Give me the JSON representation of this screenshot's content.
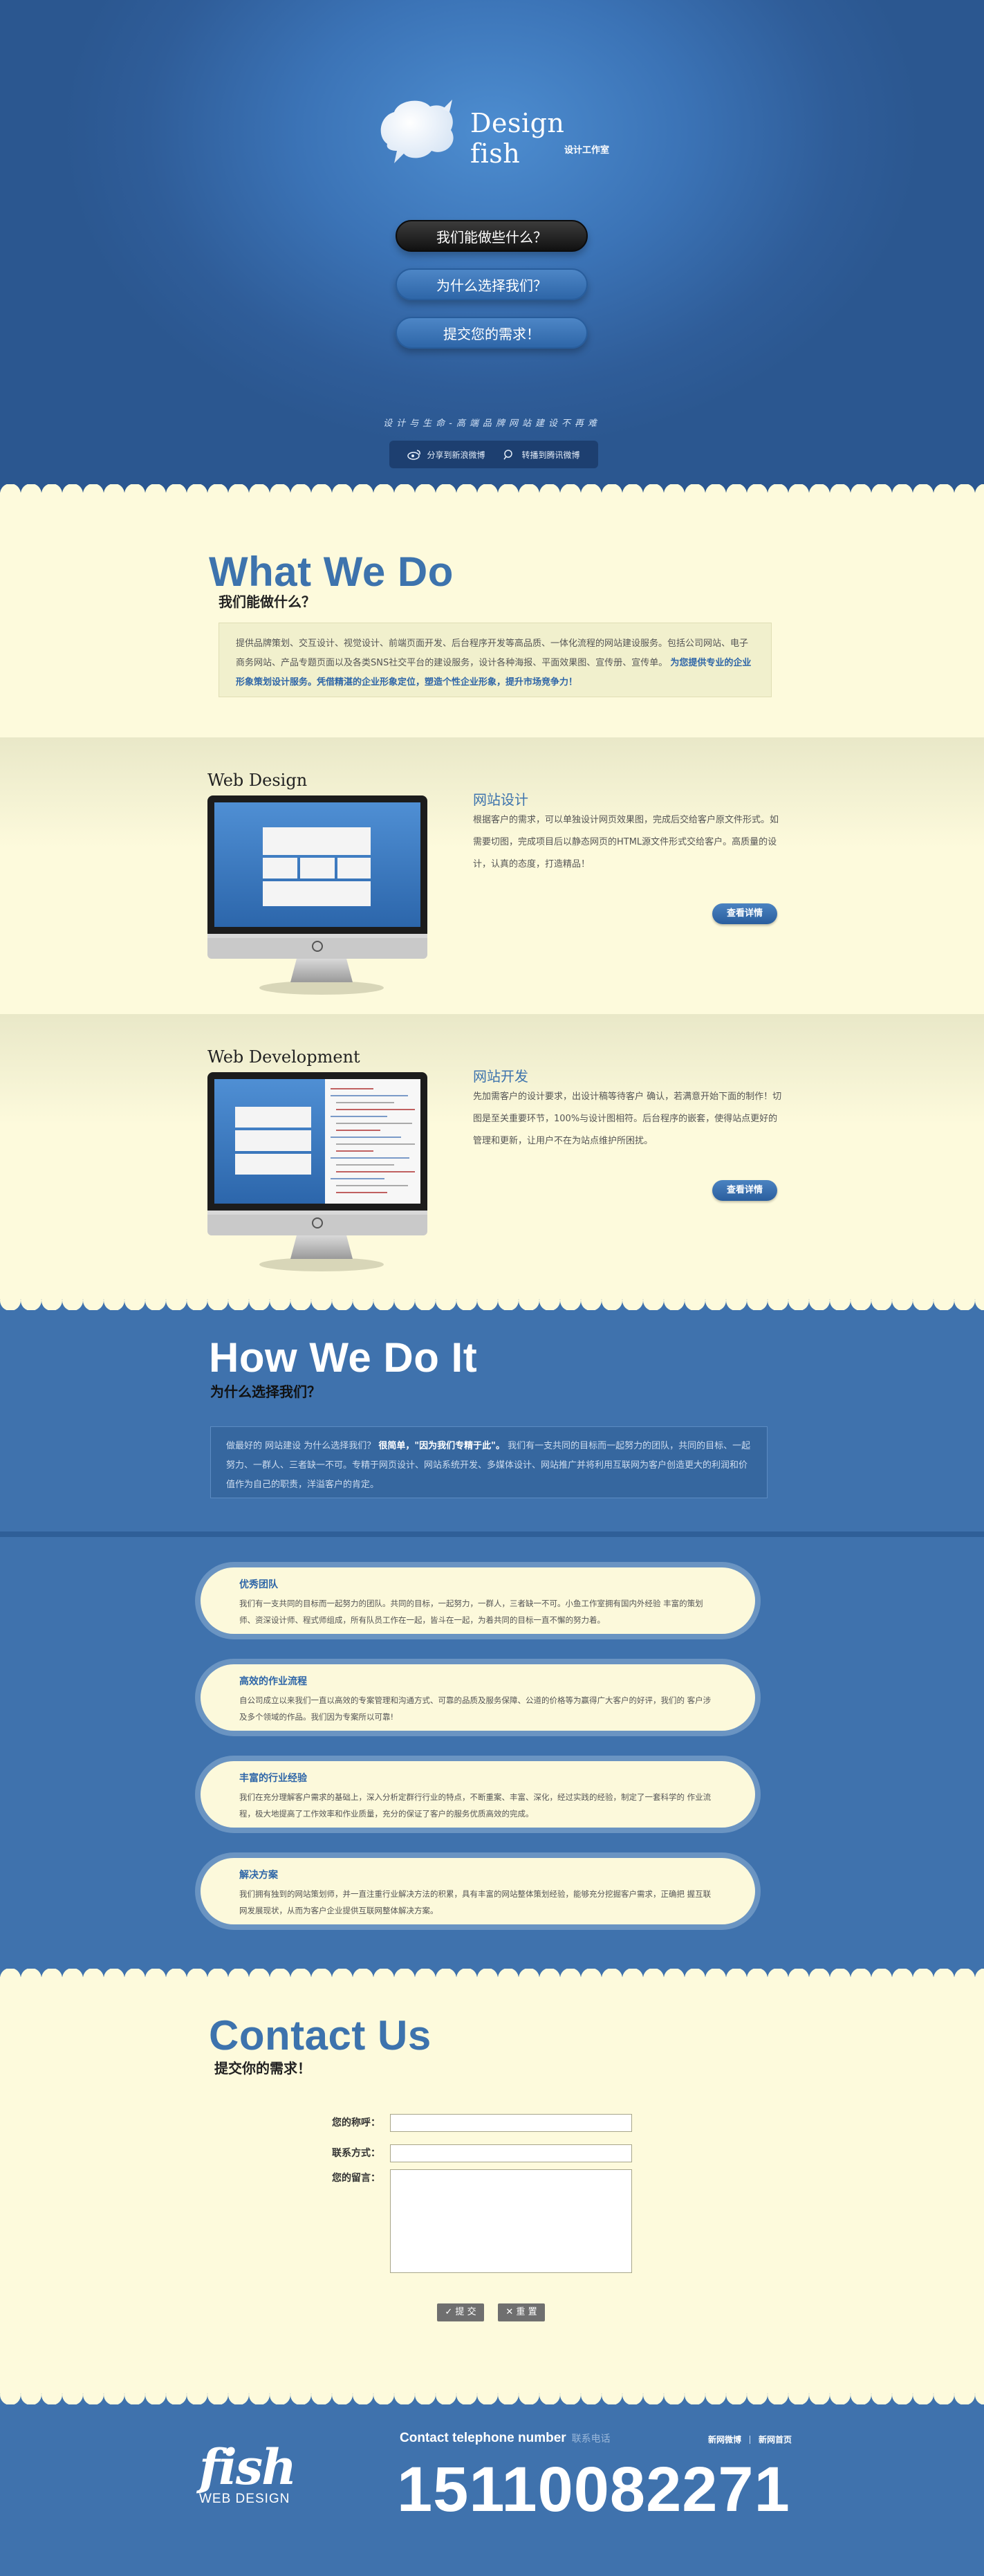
{
  "hero": {
    "logo_title": "Design fish",
    "logo_sub": "设计工作室",
    "nav": [
      {
        "label": "我们能做些什么？"
      },
      {
        "label": "为什么选择我们？"
      },
      {
        "label": "提交您的需求！"
      }
    ],
    "slogan": "设计与生命-高端品牌网站建设不再难",
    "share": [
      {
        "label": "分享到新浪微博",
        "icon": "weibo-icon"
      },
      {
        "label": "转播到腾讯微博",
        "icon": "tencent-weibo-icon"
      }
    ]
  },
  "what": {
    "title": "What We Do",
    "subtitle": "我们能做什么？",
    "text": "提供品牌策划、交互设计、视觉设计、前端页面开发、后台程序开发等高品质、一体化流程的网站建设服务。包括公司网站、电子商务网站、产品专题页面以及各类SNS社交平台的建设服务，设计各种海报、平面效果图、宣传册、宣传单。",
    "highlight": "为您提供专业的企业形象策划设计服务。凭借精湛的企业形象定位，塑造个性企业形象，提升市场竞争力！"
  },
  "services": [
    {
      "heading": "Web Design",
      "name": "网站设计",
      "desc": "根据客户的需求，可以单独设计网页效果图，完成后交给客户原文件形式。如需要切图，完成项目后以静态网页的HTML源文件形式交给客户。高质量的设计，认真的态度，打造精品！",
      "button": "查看详情"
    },
    {
      "heading": "Web Development",
      "name": "网站开发",
      "desc": "先加需客户的设计要求，出设计稿等待客户    确认，若满意开始下面的制作！切图是至关重要环节，100%与设计图相符。后台程序的嵌套，使得站点更好的管理和更新，让用户不在为站点维护所困扰。",
      "button": "查看详情"
    }
  ],
  "how": {
    "title": "How We Do It",
    "subtitle": "为什么选择我们？",
    "text_a": "做最好的 网站建设 为什么选择我们？",
    "text_bold": "很简单，\"因为我们专精于此\"。",
    "text_b": "我们有一支共同的目标而一起努力的团队，共同的目标、一起努力、一群人、三者缺一不可。专精于网页设计、网站系统开发、多媒体设计、网站推广并将利用互联网为客户创造更大的利润和价值作为自己的职责，洋溢客户的肯定。"
  },
  "advantages": [
    {
      "title": "优秀团队",
      "text": "我们有一支共同的目标而一起努力的团队。共同的目标，一起努力，一群人，三者缺一不可。小鱼工作室拥有国内外经验 丰富的策划师、资深设计师、程式师组成，所有队员工作在一起，皆斗在一起，为着共同的目标一直不懈的努力着。"
    },
    {
      "title": "高效的作业流程",
      "text": "自公司成立以来我们一直以高效的专案管理和沟通方式、可靠的品质及服务保障、公道的价格等为赢得广大客户的好评，我们的 客户涉及多个领域的作品。我们因为专案所以可靠!"
    },
    {
      "title": "丰富的行业经验",
      "text": "我们在充分理解客户需求的基础上，深入分析定群行行业的特点，不断重案、丰富、深化，经过实践的经验，制定了一套科学的 作业流程，极大地提高了工作效率和作业质量，充分的保证了客户的服务优质高效的完成。"
    },
    {
      "title": "解决方案",
      "text": "我们拥有独到的网站策划师，并一直注重行业解决方法的积累，具有丰富的网站整体策划经验，能够充分挖掘客户需求，正确把 握互联网发展现状，从而为客户企业提供互联网整体解决方案。"
    }
  ],
  "contact": {
    "title": "Contact Us",
    "subtitle": "提交你的需求！",
    "name_label": "您的称呼：",
    "phone_label": "联系方式：",
    "message_label": "您的留言：",
    "submit": "✓ 提 交",
    "reset": "✕ 重 置"
  },
  "footer": {
    "logo_big": "fish",
    "logo_sub": "WEB DESIGN",
    "tel_label": "Contact telephone number",
    "tel_label_cn": "联系电话",
    "phone": "15110082271",
    "links": [
      {
        "label": "新网微博"
      },
      {
        "label": "新网首页"
      }
    ]
  },
  "colors": {
    "hero_blue": "#3b73b6",
    "title_blue": "#3d73ad",
    "cream": "#fdfadc"
  }
}
